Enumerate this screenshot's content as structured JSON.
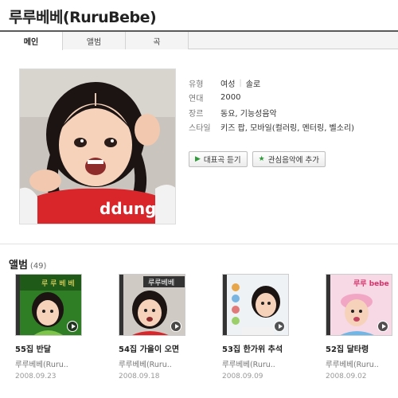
{
  "artist": {
    "name": "루루베베(RuruBebe)"
  },
  "tabs": [
    {
      "label": "메인",
      "active": true
    },
    {
      "label": "앨범",
      "active": false
    },
    {
      "label": "곡",
      "active": false
    }
  ],
  "profile": {
    "photo_icon": "artist-photo",
    "info": [
      {
        "key": "유형",
        "values": [
          "여성",
          "솔로"
        ]
      },
      {
        "key": "연대",
        "values": [
          "2000"
        ]
      },
      {
        "key": "장르",
        "values": [
          "동요, 기능성음악"
        ]
      },
      {
        "key": "스타일",
        "values": [
          "키즈 팝, 모바일(컬러링, 멘터링, 벨소리)"
        ]
      }
    ],
    "buttons": {
      "play_label": "대표곡 듣기",
      "fav_label": "관심음악에 추가"
    }
  },
  "albums_section": {
    "heading": "앨범",
    "count": "(49)",
    "items": [
      {
        "title": "55집 반달",
        "artist": "루루베베(Ruru..",
        "date": "2008.09.23",
        "cover_text": "루 루 베 베",
        "accent": "#1f6d1a"
      },
      {
        "title": "54집 가을이 오면",
        "artist": "루루베베(Ruru..",
        "date": "2008.09.18",
        "cover_text": "루루베베",
        "accent": "#333333"
      },
      {
        "title": "53집 한가위 추석",
        "artist": "루루베베(Ruru..",
        "date": "2008.09.09",
        "cover_text": "",
        "accent": "#e9eef2"
      },
      {
        "title": "52집 달타령",
        "artist": "루루베베(Ruru..",
        "date": "2008.09.02",
        "cover_text": "루루 bebe",
        "accent": "#f1a6c4"
      }
    ]
  },
  "colors": {
    "tab_border": "#5a5a5a",
    "button_icon": "#2e9a3a"
  }
}
